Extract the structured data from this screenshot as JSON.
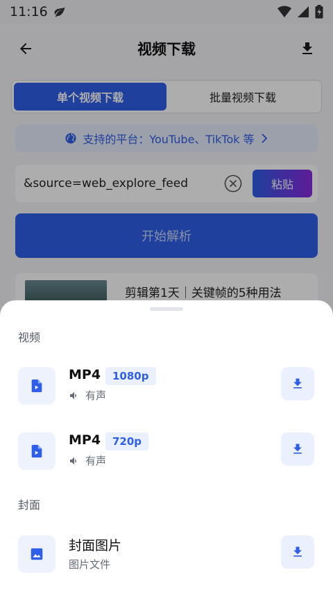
{
  "status_bar": {
    "time": "11:16"
  },
  "app_bar": {
    "title": "视频下载"
  },
  "tabs": [
    {
      "label": "单个视频下载",
      "active": true
    },
    {
      "label": "批量视频下载",
      "active": false
    }
  ],
  "platforms": {
    "text": "支持的平台：YouTube、TikTok 等"
  },
  "url_input": {
    "value": "&source=web_explore_feed"
  },
  "paste_button": {
    "label": "粘贴"
  },
  "parse_button": {
    "label": "开始解析"
  },
  "history": {
    "title": "剪辑第1天｜关键帧的5种用法"
  },
  "sheet": {
    "video_section": "视频",
    "videos": [
      {
        "format": "MP4",
        "quality": "1080p",
        "audio": "有声"
      },
      {
        "format": "MP4",
        "quality": "720p",
        "audio": "有声"
      }
    ],
    "cover_section": "封面",
    "cover": {
      "title": "封面图片",
      "subtitle": "图片文件"
    }
  },
  "colors": {
    "accent": "#2f5fe8",
    "accent_light": "#eaf0fd",
    "gradient_end": "#8a28e0"
  }
}
